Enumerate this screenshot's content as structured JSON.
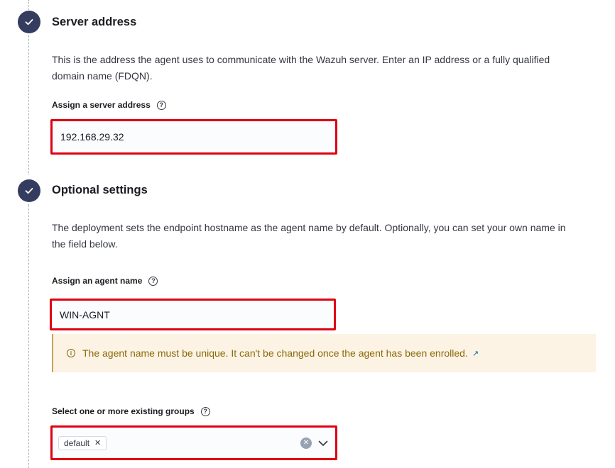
{
  "steps": [
    {
      "title": "Server address",
      "description_line1": "This is the address the agent uses to communicate with the Wazuh server. Enter an IP address or a fully qualified",
      "description_line2": "domain name (FDQN).",
      "field_label": "Assign a server address",
      "field_value": "192.168.29.32"
    },
    {
      "title": "Optional settings",
      "description_line1": "The deployment sets the endpoint hostname as the agent name by default. Optionally, you can set your own name in",
      "description_line2": "the field below.",
      "field_label": "Assign an agent name",
      "field_value": "WIN-AGNT",
      "callout_text": "The agent name must be unique. It can't be changed once the agent has been enrolled.",
      "groups_label": "Select one or more existing groups",
      "groups_selected": [
        "default"
      ]
    }
  ],
  "icons": {
    "step_complete": "check-icon",
    "help": "question-circle-icon",
    "warning": "info-circle-icon",
    "external_link": "external-link-icon",
    "chip_remove": "cross-icon",
    "clear": "clear-icon",
    "dropdown": "chevron-down-icon"
  },
  "colors": {
    "step_badge": "#343d5f",
    "highlight_border": "#e00010",
    "callout_bg": "#fcf3e4",
    "callout_text": "#8a6a0a"
  }
}
